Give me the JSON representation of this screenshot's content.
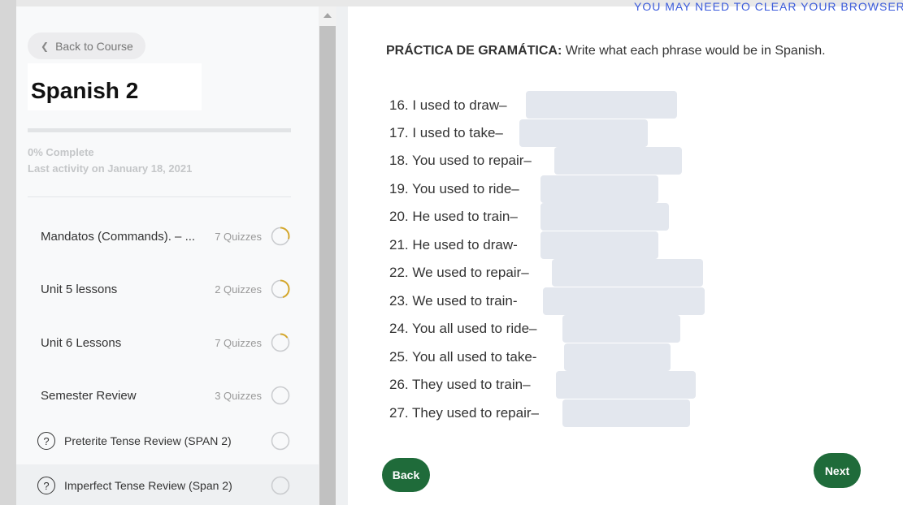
{
  "sidebar": {
    "back_label": "Back to Course",
    "course_title": "Spanish 2",
    "progress_percent": 0,
    "progress_text": "0% Complete",
    "last_activity": "Last activity on January 18, 2021",
    "sections": [
      {
        "label": "Mandatos (Commands). – ...",
        "count": "7 Quizzes",
        "progress": 0.3
      },
      {
        "label": "Unit 5 lessons",
        "count": "2 Quizzes",
        "progress": 0.45
      },
      {
        "label": "Unit 6 Lessons",
        "count": "7 Quizzes",
        "progress": 0.15
      },
      {
        "label": "Semester Review",
        "count": "3 Quizzes",
        "progress": 0
      }
    ],
    "quizzes": [
      {
        "icon": "?",
        "label": "Preterite Tense Review (SPAN 2)"
      },
      {
        "icon": "?",
        "label": "Imperfect Tense Review (Span 2)"
      }
    ]
  },
  "content": {
    "top_notice": "YOU MAY NEED TO CLEAR YOUR BROWSER",
    "heading_bold": "PRÁCTICA DE GRAMÁTICA:",
    "heading_rest": " Write what each phrase would be in Spanish.",
    "questions": [
      "16. I used to draw–",
      "17. I used to take–",
      "18. You used to repair–",
      "19. You used to ride–",
      "20. He used to train–",
      "21. He used to draw-",
      "22. We used to repair–",
      "23. We used to train-",
      "24. You all used to ride–",
      "25. You all used to take-",
      "26. They used to train–",
      "27. They used to repair–"
    ],
    "back_label": "Back",
    "next_label": "Next"
  },
  "colors": {
    "button_green": "#1f6b3a",
    "ring_gold": "#d4a72c",
    "blank_fill": "#e3e7ee"
  }
}
